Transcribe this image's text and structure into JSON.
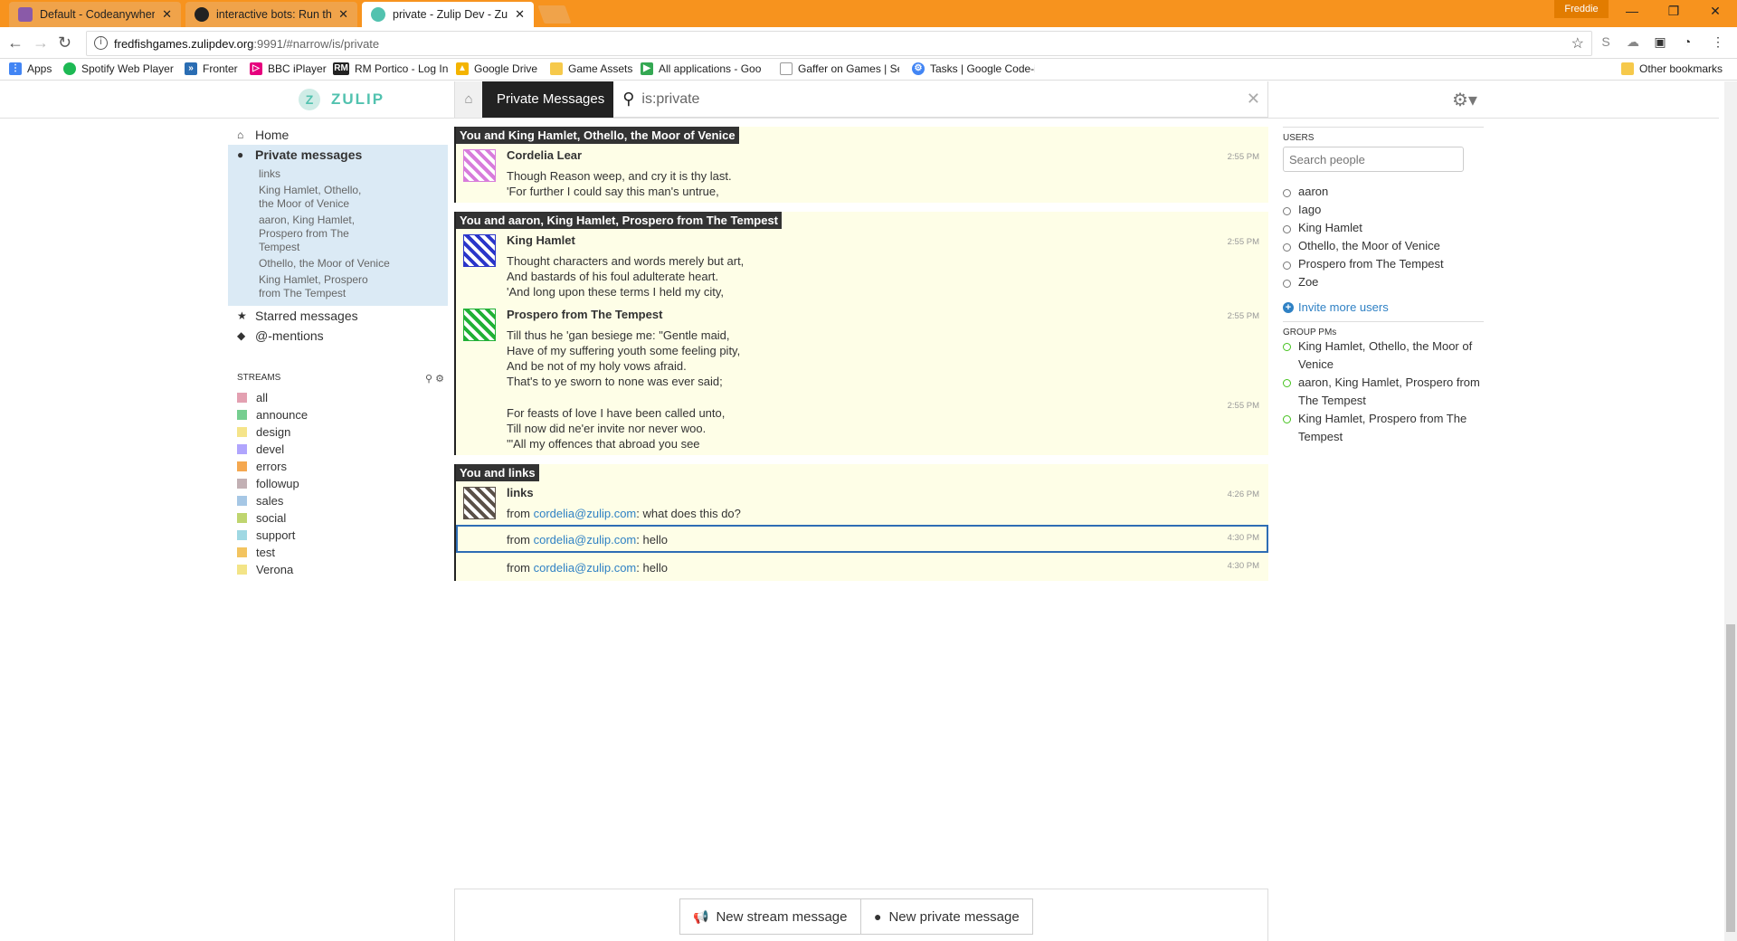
{
  "browser": {
    "tabs": [
      {
        "title": "Default - Codeanywhere",
        "icon_color": "#8a5aa8",
        "active": false
      },
      {
        "title": "interactive bots: Run the",
        "icon_color": "#222222",
        "active": false
      },
      {
        "title": "private - Zulip Dev - Zuli",
        "icon_color": "#52c2af",
        "active": true
      }
    ],
    "tab_close": "✕",
    "user_badge": "Freddie",
    "url_host": "fredfishgames.zulipdev.org",
    "url_path": ":9991/#narrow/is/private",
    "bookmarks": [
      {
        "label": "Apps",
        "color": "#4285f4"
      },
      {
        "label": "Spotify Web Player",
        "color": "#1db954"
      },
      {
        "label": "Fronter",
        "color": "#2a6db3"
      },
      {
        "label": "BBC iPlayer",
        "color": "#e6007e"
      },
      {
        "label": "RM Portico - Log In",
        "color": "#222222"
      },
      {
        "label": "Google Drive",
        "color": "#f4b400"
      },
      {
        "label": "Game Assets",
        "color": "#f6c94b"
      },
      {
        "label": "All applications - Goo",
        "color": "#34a853"
      },
      {
        "label": "Gaffer on Games | Ser",
        "color": "#999999"
      },
      {
        "label": "Tasks | Google Code-i",
        "color": "#4285f4"
      }
    ],
    "other_bookmarks": "Other bookmarks"
  },
  "header": {
    "logo": "ZULIP",
    "breadcrumb": "Private Messages",
    "search_term": "is:private"
  },
  "sidebar": {
    "home": "Home",
    "private_messages": "Private messages",
    "pm_list": [
      "links",
      "King Hamlet, Othello, the Moor of Venice",
      "aaron, King Hamlet, Prospero from The Tempest",
      "Othello, the Moor of Venice",
      "King Hamlet, Prospero from The Tempest"
    ],
    "starred": "Starred messages",
    "mentions": "@-mentions",
    "streams_title": "STREAMS",
    "streams": [
      {
        "name": "all",
        "color": "#e3a0b1"
      },
      {
        "name": "announce",
        "color": "#76ce90"
      },
      {
        "name": "design",
        "color": "#f5e48a"
      },
      {
        "name": "devel",
        "color": "#b0a5fd"
      },
      {
        "name": "errors",
        "color": "#f5a850"
      },
      {
        "name": "followup",
        "color": "#c2b0b4"
      },
      {
        "name": "sales",
        "color": "#a6c7e5"
      },
      {
        "name": "social",
        "color": "#bfd56f"
      },
      {
        "name": "support",
        "color": "#9fd8e3"
      },
      {
        "name": "test",
        "color": "#f3c460"
      },
      {
        "name": "Verona",
        "color": "#f3e487"
      }
    ]
  },
  "messages": [
    {
      "recipient": "You and King Hamlet, Othello, the Moor of Venice",
      "items": [
        {
          "sender": "Cordelia Lear",
          "time": "2:55 PM",
          "lines": [
            "Though Reason weep, and cry it is thy last.",
            "'For further I could say this man's untrue,"
          ]
        }
      ]
    },
    {
      "recipient": "You and aaron, King Hamlet, Prospero from The Tempest",
      "items": [
        {
          "sender": "King Hamlet",
          "time": "2:55 PM",
          "lines": [
            "Thought characters and words merely but art,",
            "And bastards of his foul adulterate heart.",
            "'And long upon these terms I held my city,"
          ]
        },
        {
          "sender": "Prospero from The Tempest",
          "time": "2:55 PM",
          "lines": [
            "Till thus he 'gan besiege me: \"Gentle maid,",
            "Have of my suffering youth some feeling pity,",
            "And be not of my holy vows afraid.",
            "That's to ye sworn to none was ever said;"
          ]
        },
        {
          "sender": "",
          "time": "2:55 PM",
          "lines": [
            "For feasts of love I have been called unto,",
            "Till now did ne'er invite nor never woo.",
            "'\"All my offences that abroad you see"
          ]
        }
      ]
    },
    {
      "recipient": "You and links",
      "items": [
        {
          "sender": "links",
          "time": "4:26 PM",
          "prefix": "from ",
          "link": "cordelia@zulip.com",
          "suffix": ": what does this do?"
        },
        {
          "sender": "",
          "time": "4:30 PM",
          "prefix": "from ",
          "link": "cordelia@zulip.com",
          "suffix": ": hello",
          "selected": true
        },
        {
          "sender": "",
          "time": "4:30 PM",
          "prefix": "from ",
          "link": "cordelia@zulip.com",
          "suffix": ": hello"
        }
      ]
    }
  ],
  "right": {
    "users_title": "USERS",
    "search_placeholder": "Search people",
    "users": [
      "aaron",
      "Iago",
      "King Hamlet",
      "Othello, the Moor of Venice",
      "Prospero from The Tempest",
      "Zoe"
    ],
    "invite": "Invite more users",
    "group_title": "GROUP PMs",
    "group_pms": [
      "King Hamlet, Othello, the Moor of Venice",
      "aaron, King Hamlet, Prospero from The Tempest",
      "King Hamlet, Prospero from The Tempest"
    ]
  },
  "compose": {
    "new_stream": "New stream message",
    "new_private": "New private message"
  }
}
